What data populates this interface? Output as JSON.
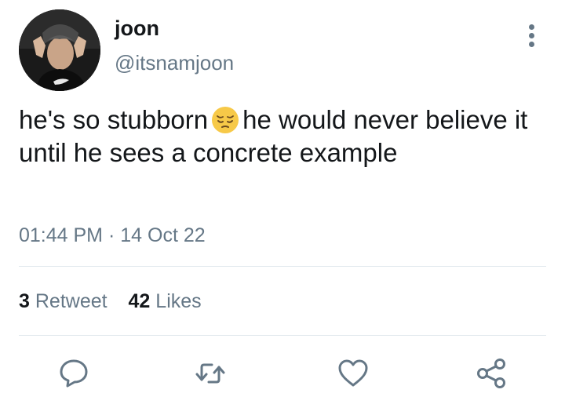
{
  "user": {
    "display_name": "joon",
    "handle": "@itsnamjoon"
  },
  "tweet": {
    "text_before_emoji": "he's so stubborn",
    "emoji_icon": "pensive-face-icon",
    "text_after_emoji": "he would never believe it until he sees a concrete example",
    "time": "01:44 PM",
    "separator": "·",
    "date": "14 Oct 22"
  },
  "stats": {
    "retweets_count": "3",
    "retweets_label": "Retweet",
    "likes_count": "42",
    "likes_label": "Likes"
  },
  "actions": [
    {
      "name": "reply",
      "icon": "speech-bubble-icon"
    },
    {
      "name": "retweet",
      "icon": "retweet-arrows-icon"
    },
    {
      "name": "like",
      "icon": "heart-icon"
    },
    {
      "name": "share",
      "icon": "share-nodes-icon"
    }
  ],
  "colors": {
    "primary_text": "#14171a",
    "secondary_text": "#657786",
    "divider": "#e1e8ed",
    "emoji_yellow": "#f7c948"
  }
}
